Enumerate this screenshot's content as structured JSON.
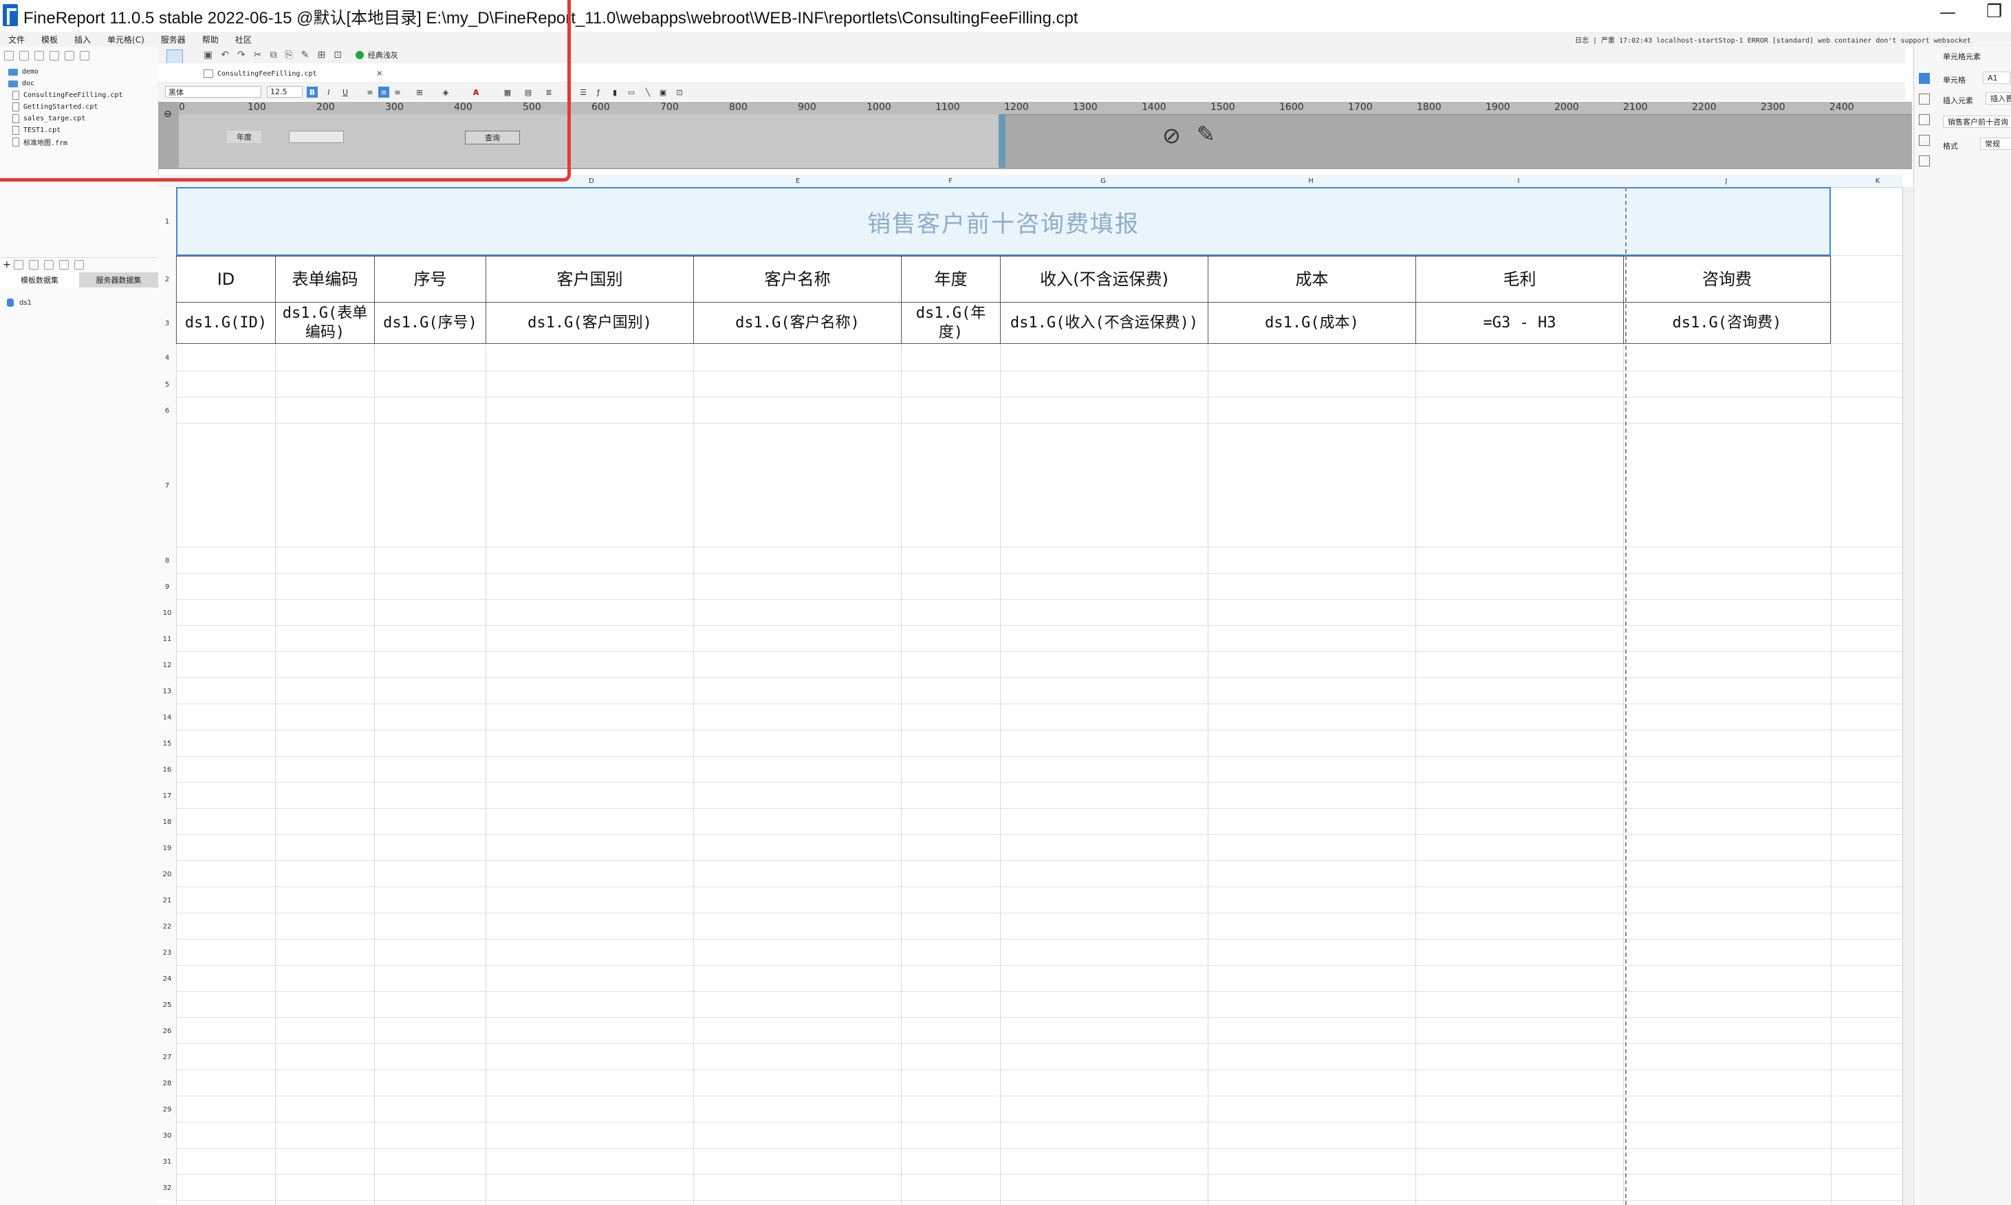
{
  "window": {
    "title": "FineReport 11.0.5 stable 2022-06-15 @默认[本地目录]    E:\\my_D\\FineReport_11.0\\webapps\\webroot\\WEB-INF\\reportlets\\ConsultingFeeFilling.cpt",
    "minimize": "—",
    "restore": "❐"
  },
  "menu": [
    "文件",
    "模板",
    "插入",
    "单元格(C)",
    "服务器",
    "帮助",
    "社区"
  ],
  "log_text": "日志 | 严重 17:02:43 localhost-startStop-1 ERROR [standard] web container don't support websocket",
  "file_tree": [
    {
      "type": "folder",
      "name": "demo"
    },
    {
      "type": "folder",
      "name": "doc"
    },
    {
      "type": "file",
      "name": "ConsultingFeeFilling.cpt"
    },
    {
      "type": "file",
      "name": "GettingStarted.cpt"
    },
    {
      "type": "file",
      "name": "sales_targe.cpt"
    },
    {
      "type": "file",
      "name": "TEST1.cpt"
    },
    {
      "type": "file",
      "name": "标准地图.frm"
    }
  ],
  "dataset_tabs": {
    "template": "模板数据集",
    "server": "服务器数据集"
  },
  "dataset_item": "ds1",
  "toolbar": {
    "theme": "经典浅灰"
  },
  "doc_tab": {
    "name": "ConsultingFeeFilling.cpt",
    "close": "×"
  },
  "format": {
    "font": "黑体",
    "size": "12.5",
    "bold": "B",
    "italic": "I",
    "underline": "U"
  },
  "param": {
    "year_label": "年度",
    "query_label": "查询"
  },
  "ruler_ticks": [
    "0",
    "100",
    "200",
    "300",
    "400",
    "500",
    "600",
    "700",
    "800",
    "900",
    "1000",
    "1100",
    "1200",
    "1300",
    "1400",
    "1500",
    "1600",
    "1700",
    "1800",
    "1900",
    "2000",
    "2100",
    "2200",
    "2300",
    "2400"
  ],
  "right_panel": {
    "title": "单元格元素",
    "cell_label": "单元格",
    "cell_value": "A1",
    "insert_label": "插入元素",
    "insert_value": "插入普",
    "content_value": "销售客户前十咨询",
    "format_label": "格式",
    "format_value": "常规"
  },
  "sheet": {
    "col_letters": [
      "D",
      "E",
      "F",
      "G",
      "H",
      "I",
      "J",
      "K"
    ],
    "title": "销售客户前十咨询费填报",
    "headers": [
      "ID",
      "表单编码",
      "序号",
      "客户国别",
      "客户名称",
      "年度",
      "收入(不含运保费)",
      "成本",
      "毛利",
      "咨询费"
    ],
    "data": [
      "ds1.G(ID)",
      "ds1.G(表单编码)",
      "ds1.G(序号)",
      "ds1.G(客户国别)",
      "ds1.G(客户名称)",
      "ds1.G(年度)",
      "ds1.G(收入(不含运保费))",
      "ds1.G(成本)",
      "=G3 - H3",
      "ds1.G(咨询费)"
    ],
    "row_numbers": [
      "1",
      "2",
      "3",
      "4",
      "5",
      "6",
      "7",
      "8",
      "9",
      "10",
      "11",
      "12",
      "13",
      "14",
      "15",
      "16",
      "17",
      "18",
      "19",
      "20",
      "21",
      "22",
      "23",
      "24",
      "25",
      "26",
      "27",
      "28",
      "29",
      "30",
      "31",
      "32"
    ]
  }
}
